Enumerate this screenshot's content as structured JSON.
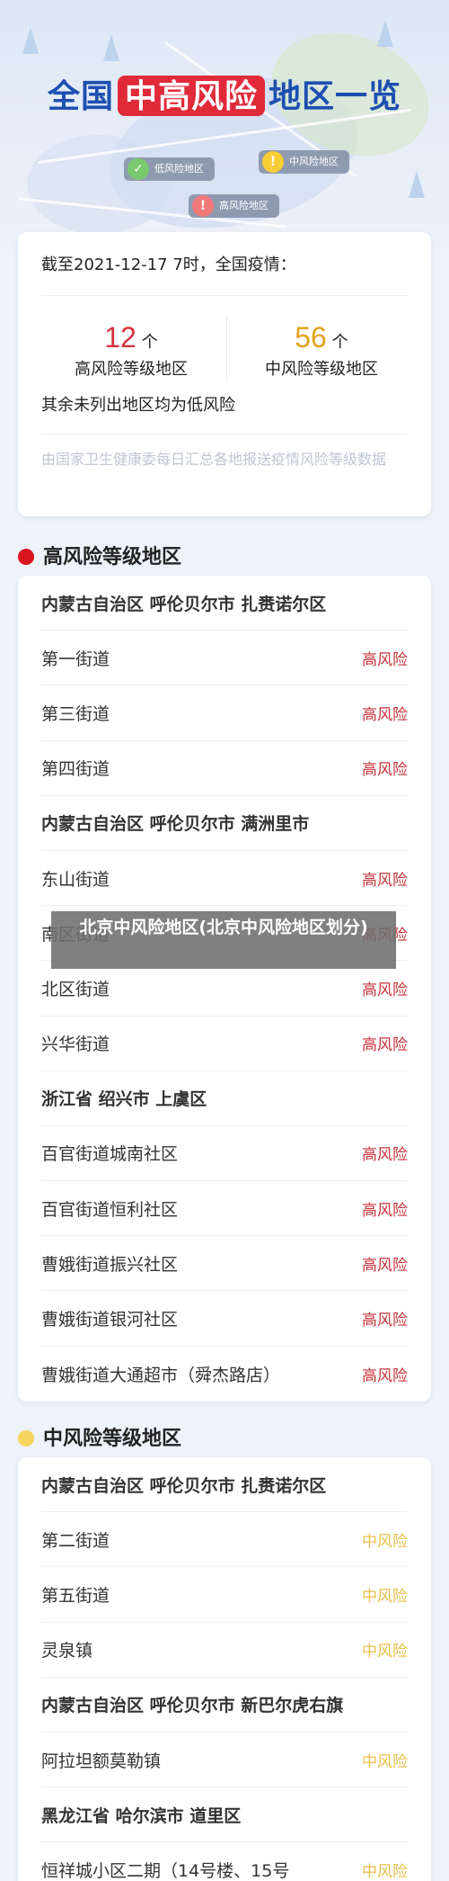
{
  "hero": {
    "title_prefix": "全国",
    "title_highlight": "中高风险",
    "title_suffix": "地区一览",
    "legend": {
      "low": {
        "icon": "✓",
        "label": "低风险地区",
        "color": "#7bc96f"
      },
      "mid": {
        "icon": "!",
        "label": "中风险地区",
        "color": "#f6cd35"
      },
      "high": {
        "icon": "!",
        "label": "高风险地区",
        "color": "#f07a7a"
      }
    }
  },
  "summary": {
    "as_of": "截至2021-12-17 7时，全国疫情：",
    "high_count": "12",
    "high_unit": "个",
    "high_caption": "高风险等级地区",
    "mid_count": "56",
    "mid_unit": "个",
    "mid_caption": "中风险等级地区",
    "rest_note": "其余未列出地区均为低风险",
    "source": "由国家卫生健康委每日汇总各地报送疫情风险等级数据"
  },
  "sections": {
    "high_title": "高风险等级地区",
    "mid_title": "中风险等级地区"
  },
  "high_list": [
    {
      "type": "group",
      "name": "内蒙古自治区 呼伦贝尔市 扎赉诺尔区"
    },
    {
      "type": "item",
      "name": "第一街道",
      "level": "高风险"
    },
    {
      "type": "item",
      "name": "第三街道",
      "level": "高风险"
    },
    {
      "type": "item",
      "name": "第四街道",
      "level": "高风险"
    },
    {
      "type": "group",
      "name": "内蒙古自治区 呼伦贝尔市 满洲里市"
    },
    {
      "type": "item",
      "name": "东山街道",
      "level": "高风险"
    },
    {
      "type": "item",
      "name": "南区街道",
      "level": "高风险"
    },
    {
      "type": "item",
      "name": "北区街道",
      "level": "高风险"
    },
    {
      "type": "item",
      "name": "兴华街道",
      "level": "高风险"
    },
    {
      "type": "group",
      "name": "浙江省 绍兴市 上虞区"
    },
    {
      "type": "item",
      "name": "百官街道城南社区",
      "level": "高风险"
    },
    {
      "type": "item",
      "name": "百官街道恒利社区",
      "level": "高风险"
    },
    {
      "type": "item",
      "name": "曹娥街道振兴社区",
      "level": "高风险"
    },
    {
      "type": "item",
      "name": "曹娥街道银河社区",
      "level": "高风险"
    },
    {
      "type": "item",
      "name": "曹娥街道大通超市（舜杰路店）",
      "level": "高风险"
    }
  ],
  "mid_list": [
    {
      "type": "group",
      "name": "内蒙古自治区 呼伦贝尔市 扎赉诺尔区"
    },
    {
      "type": "item",
      "name": "第二街道",
      "level": "中风险"
    },
    {
      "type": "item",
      "name": "第五街道",
      "level": "中风险"
    },
    {
      "type": "item",
      "name": "灵泉镇",
      "level": "中风险"
    },
    {
      "type": "group",
      "name": "内蒙古自治区 呼伦贝尔市 新巴尔虎右旗"
    },
    {
      "type": "item",
      "name": "阿拉坦额莫勒镇",
      "level": "中风险"
    },
    {
      "type": "group",
      "name": "黑龙江省 哈尔滨市 道里区"
    },
    {
      "type": "item",
      "name": "恒祥城小区二期（14号楼、15号",
      "level": "中风险"
    }
  ],
  "overlay_caption": "北京中风险地区(北京中风险地区划分)"
}
